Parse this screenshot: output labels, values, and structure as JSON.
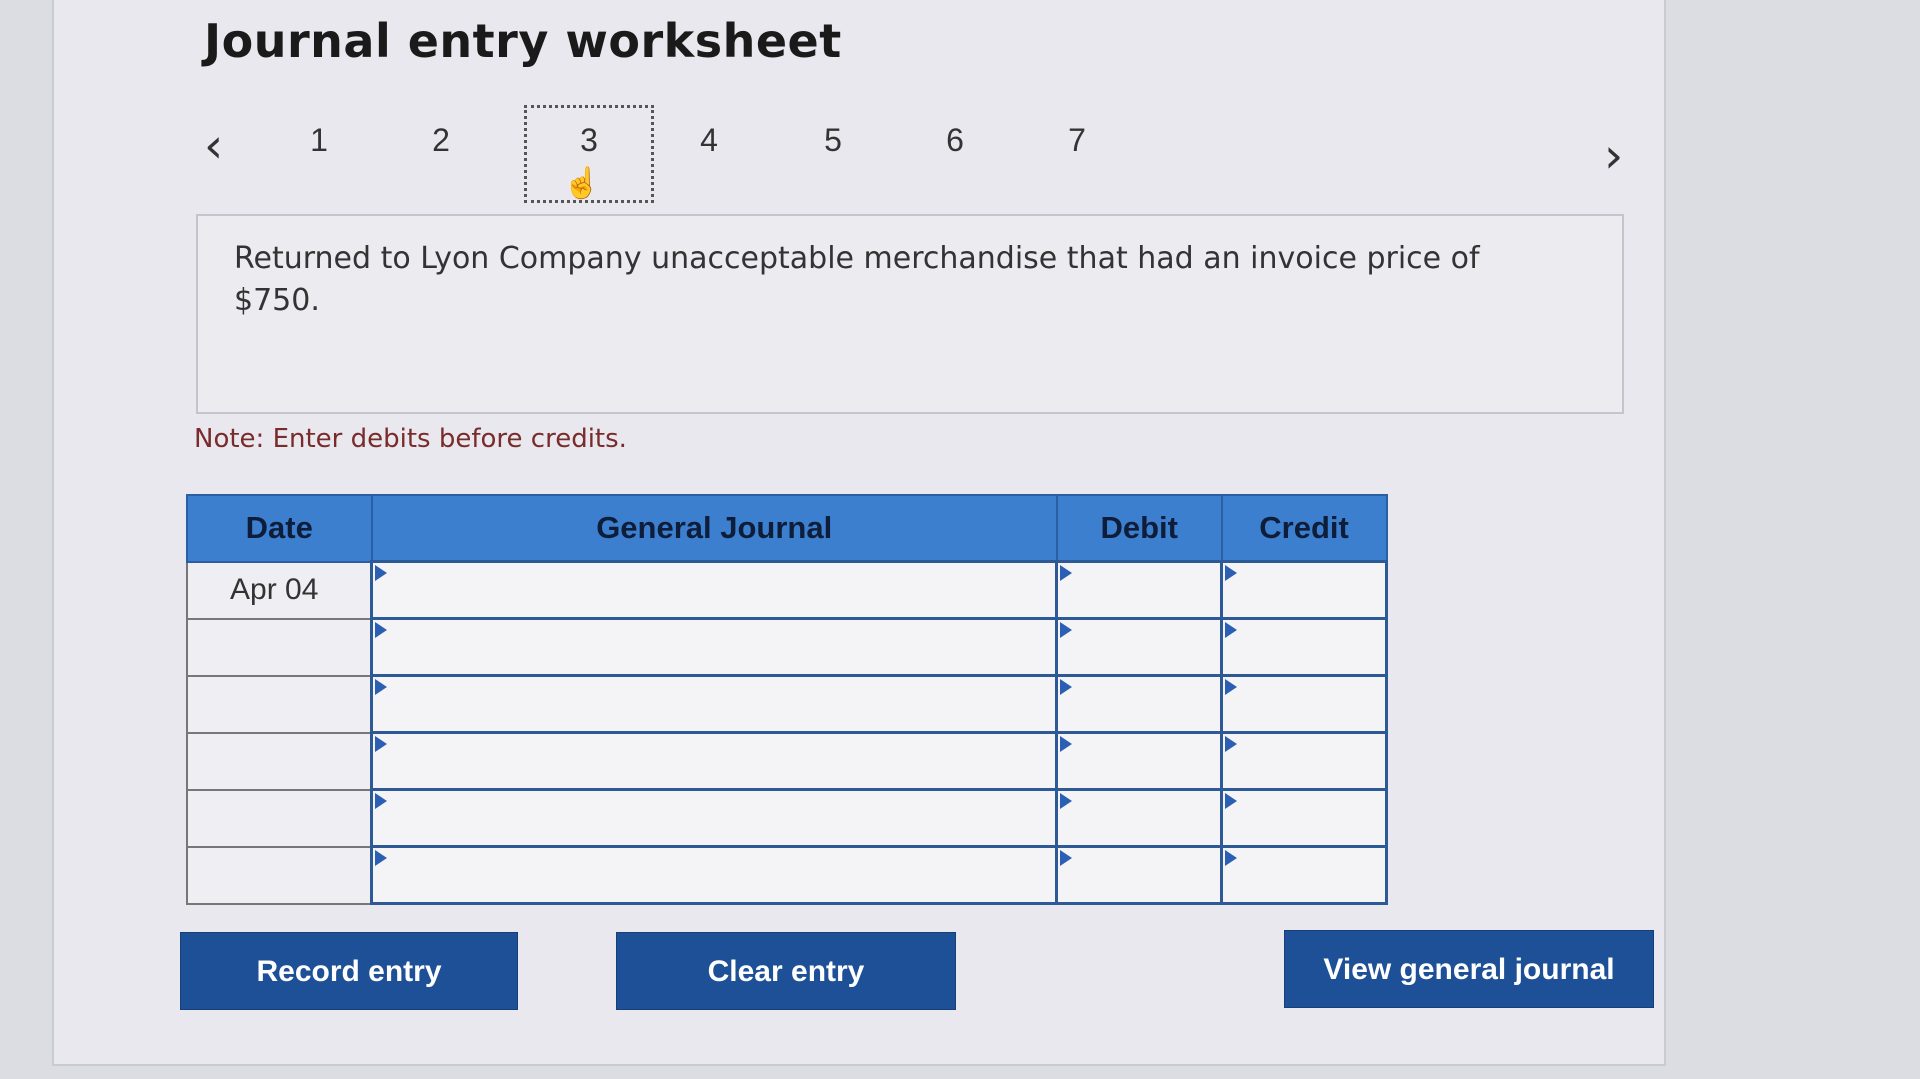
{
  "header": {
    "title": "Journal entry worksheet"
  },
  "nav": {
    "prev_icon": "chevron-left-icon",
    "next_icon": "chevron-right-icon",
    "steps": [
      "1",
      "2",
      "3",
      "4",
      "5",
      "6",
      "7"
    ],
    "active_step": "3"
  },
  "description": {
    "text": "Returned to Lyon Company unacceptable merchandise that had an invoice price of $750."
  },
  "note": "Note: Enter debits before credits.",
  "journal": {
    "headers": {
      "date": "Date",
      "general_journal": "General Journal",
      "debit": "Debit",
      "credit": "Credit"
    },
    "rows": [
      {
        "date": "Apr 04",
        "account": "",
        "debit": "",
        "credit": ""
      },
      {
        "date": "",
        "account": "",
        "debit": "",
        "credit": ""
      },
      {
        "date": "",
        "account": "",
        "debit": "",
        "credit": ""
      },
      {
        "date": "",
        "account": "",
        "debit": "",
        "credit": ""
      },
      {
        "date": "",
        "account": "",
        "debit": "",
        "credit": ""
      },
      {
        "date": "",
        "account": "",
        "debit": "",
        "credit": ""
      }
    ]
  },
  "buttons": {
    "record": "Record entry",
    "clear": "Clear entry",
    "view": "View general journal"
  },
  "colors": {
    "header_blue": "#3d7fcf",
    "button_blue": "#1d5096",
    "cell_border": "#2d5a96"
  }
}
